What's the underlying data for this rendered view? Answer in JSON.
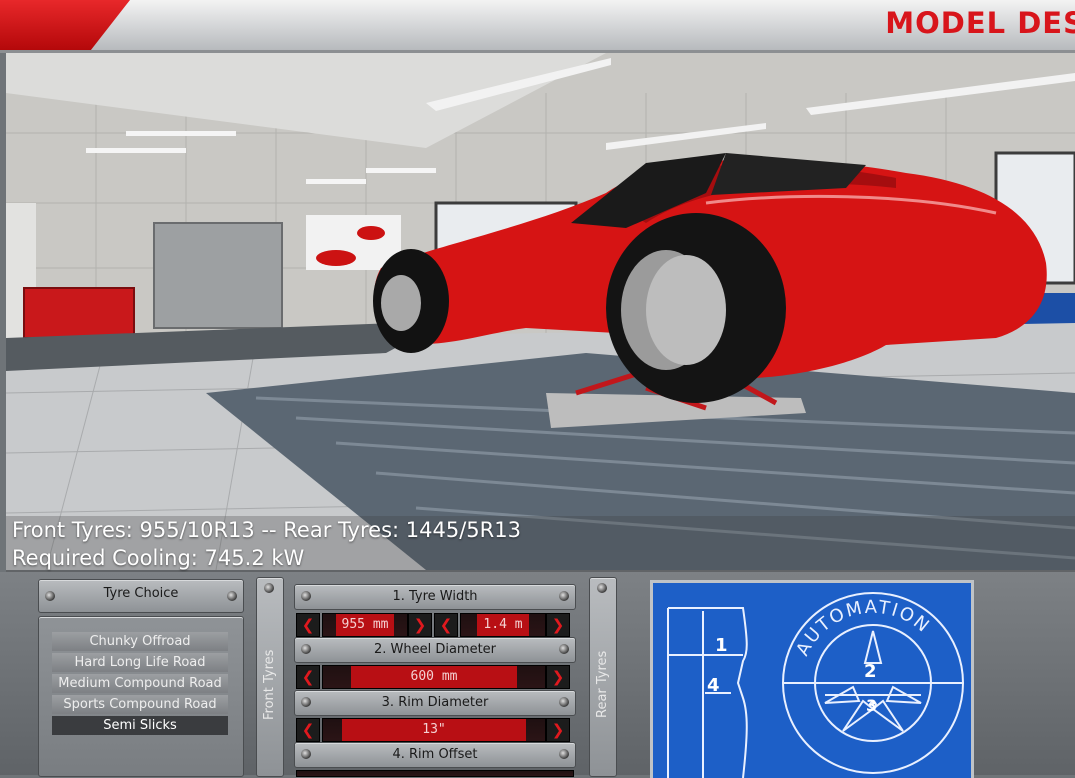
{
  "header": {
    "title": "MODEL DES"
  },
  "info": {
    "tyres_line": "Front Tyres: 955/10R13 -- Rear Tyres: 1445/5R13",
    "cooling_line": "Required Cooling: 745.2 kW"
  },
  "tyre_choice": {
    "title": "Tyre Choice",
    "options": [
      {
        "label": "Chunky Offroad"
      },
      {
        "label": "Hard Long Life Road"
      },
      {
        "label": "Medium Compound Road"
      },
      {
        "label": "Sports Compound Road"
      },
      {
        "label": "Semi Slicks"
      }
    ],
    "selected": "Semi Slicks"
  },
  "side_labels": {
    "front": "Front Tyres",
    "rear": "Rear Tyres"
  },
  "params": {
    "tyre_width": {
      "title": "1. Tyre Width",
      "front_value": "955 mm",
      "rear_value": "1.4 m"
    },
    "wheel_diameter": {
      "title": "2. Wheel Diameter",
      "value": "600 mm"
    },
    "rim_diameter": {
      "title": "3. Rim Diameter",
      "value": "13\""
    },
    "rim_offset": {
      "title": "4. Rim Offset"
    }
  },
  "blueprint": {
    "brand": "AUTOMATION",
    "labels": [
      "1",
      "2",
      "3",
      "4"
    ]
  },
  "colors": {
    "accent_red": "#e0191e",
    "blueprint_blue": "#1d5fc7",
    "car_red": "#d61414"
  }
}
